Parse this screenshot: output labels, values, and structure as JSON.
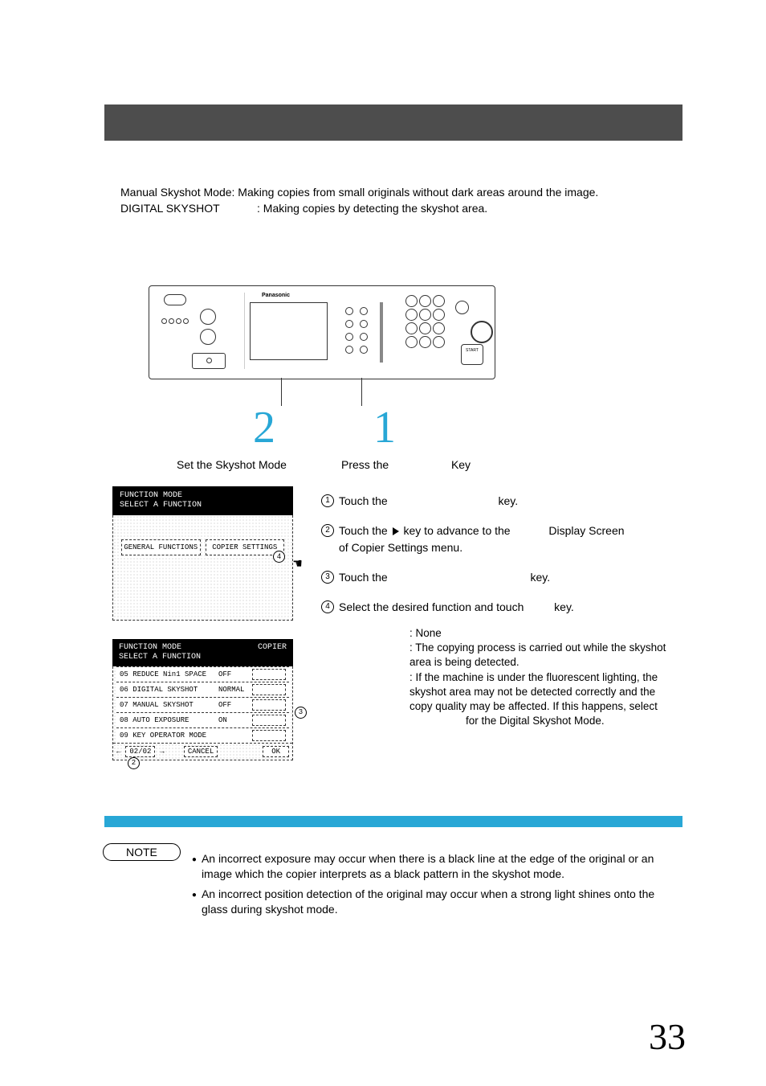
{
  "intro": {
    "row1_label": "Manual Skyshot Mode",
    "row1_text": ": Making copies from small originals without dark areas around the image.",
    "row2_label": "DIGITAL SKYSHOT",
    "row2_text": ": Making copies by detecting the skyshot area."
  },
  "panel": {
    "brand": "Panasonic",
    "start": "START"
  },
  "bignum": {
    "one": "1",
    "two": "2"
  },
  "labels": {
    "set_mode": "Set the Skyshot Mode",
    "press_key_left": "Press the",
    "press_key_right": "Key"
  },
  "screen1": {
    "line1": "FUNCTION MODE",
    "line2": "SELECT A FUNCTION",
    "btn1": "GENERAL FUNCTIONS",
    "btn2": "COPIER SETTINGS"
  },
  "screen2": {
    "hline1": "FUNCTION MODE",
    "hline2": "SELECT A FUNCTION",
    "hright": "COPIER",
    "rows": [
      {
        "label": "05 REDUCE Nin1 SPACE",
        "val": "OFF"
      },
      {
        "label": "06 DIGITAL SKYSHOT",
        "val": "NORMAL"
      },
      {
        "label": "07 MANUAL SKYSHOT",
        "val": "OFF"
      },
      {
        "label": "08 AUTO EXPOSURE",
        "val": "ON"
      },
      {
        "label": "09 KEY OPERATOR MODE",
        "val": ""
      }
    ],
    "footer_nav": "02/02",
    "footer_cancel": "CANCEL",
    "footer_ok": "OK"
  },
  "steps": {
    "s1": {
      "a": "Touch the",
      "b": "key."
    },
    "s2": {
      "a": "Touch the ",
      "b": " key to advance to the",
      "c": "of Copier Settings menu.",
      "right": "Display Screen"
    },
    "s3": {
      "a": "Touch the",
      "b": "key."
    },
    "s4": {
      "a": "Select the desired function and touch",
      "b": "key."
    }
  },
  "subdesc": {
    "none": ": None",
    "l2": ": The copying process is carried out while the skyshot area is being detected.",
    "l3a": ": If the machine is under the fluorescent lighting, the skyshot area may not be detected correctly and the copy quality may be affected. If this happens, select",
    "l3b": "for the Digital Skyshot Mode."
  },
  "note": {
    "title": "NOTE",
    "items": [
      "An incorrect exposure may occur when there is a black line at the edge of the original or an image which the copier interprets as a black pattern in the skyshot mode.",
      "An incorrect position detection of the original may occur when a strong light shines onto the glass during skyshot mode."
    ]
  },
  "page_number": "33",
  "badges": {
    "b2": "2",
    "b3": "3",
    "b4": "4"
  }
}
